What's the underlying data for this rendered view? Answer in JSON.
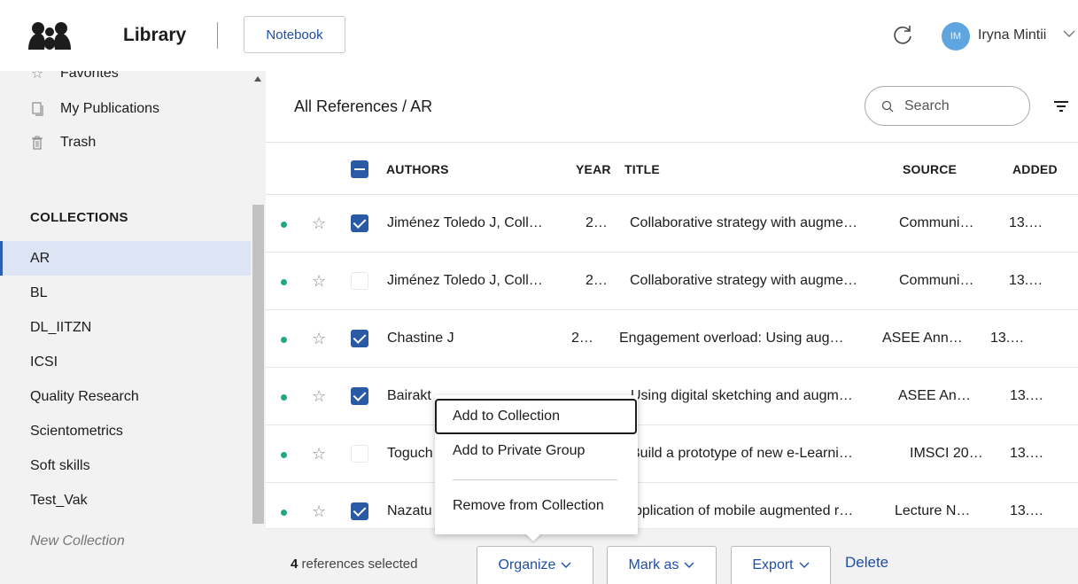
{
  "header": {
    "title": "Library",
    "notebook_label": "Notebook",
    "user_initials": "IM",
    "user_name": "Iryna Mintii"
  },
  "sidebar": {
    "top_items": [
      {
        "label": "Favorites",
        "icon": "star-icon"
      },
      {
        "label": "My Publications",
        "icon": "document-icon"
      },
      {
        "label": "Trash",
        "icon": "trash-icon"
      }
    ],
    "collections_heading": "COLLECTIONS",
    "collections": [
      "AR",
      "BL",
      "DL_IITZN",
      "ICSI",
      "Quality Research",
      "Scientometrics",
      "Soft skills",
      "Test_Vak"
    ],
    "active_collection": "AR",
    "new_collection_label": "New Collection"
  },
  "main": {
    "breadcrumb": "All References / AR",
    "search_placeholder": "Search",
    "columns": {
      "authors": "AUTHORS",
      "year": "YEAR",
      "title": "TITLE",
      "source": "SOURCE",
      "added": "ADDED"
    },
    "rows": [
      {
        "authors": "Jiménez Toledo J, Coll…",
        "year": "2…",
        "title": "Collaborative strategy with augme…",
        "source": "Communi…",
        "added": "13.…",
        "checked": true
      },
      {
        "authors": "Jiménez Toledo J, Coll…",
        "year": "2…",
        "title": "Collaborative strategy with augme…",
        "source": "Communi…",
        "added": "13.…",
        "checked": false
      },
      {
        "authors": "Chastine J",
        "year": "2…",
        "title": "Engagement overload: Using aug…",
        "source": "ASEE Ann…",
        "added": "13.…",
        "checked": true
      },
      {
        "authors": "Bairakt",
        "year": "",
        "title": "Using digital sketching and augm…",
        "source": "ASEE An…",
        "added": "13.…",
        "checked": true
      },
      {
        "authors": "Toguch",
        "year": "",
        "title": "Build a prototype of new e-Learni…",
        "source": "IMSCI 20…",
        "added": "13.…",
        "checked": false
      },
      {
        "authors": "Nazatu",
        "year": "",
        "title": "pplication of mobile augmented r…",
        "source": "Lecture N…",
        "added": "13.…",
        "checked": true
      }
    ]
  },
  "bottom_bar": {
    "selected_count": "4",
    "selected_suffix": " references selected",
    "organize_label": "Organize",
    "mark_as_label": "Mark as",
    "export_label": "Export",
    "delete_label": "Delete"
  },
  "organize_menu": {
    "items": [
      "Add to Collection",
      "Add to Private Group",
      "Remove from Collection"
    ]
  },
  "colors": {
    "accent": "#2a5aa6",
    "link": "#1f4ea8",
    "status_dot": "#1ea886",
    "avatar": "#5fa5e0"
  }
}
